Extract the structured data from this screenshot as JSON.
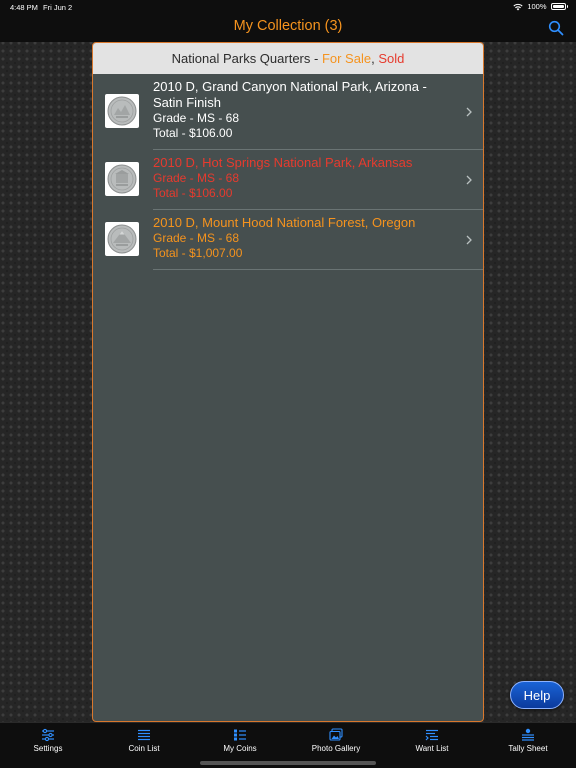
{
  "status_bar": {
    "time": "4:48 PM",
    "date": "Fri Jun 2",
    "battery": "100%"
  },
  "nav": {
    "title": "My Collection (3)"
  },
  "panel": {
    "header_prefix": "National Parks Quarters - ",
    "header_for_sale": "For Sale",
    "header_comma": ", ",
    "header_sold": "Sold"
  },
  "coins": [
    {
      "title": "2010 D, Grand Canyon National Park, Arizona - Satin Finish",
      "grade": "Grade - MS - 68",
      "total": "Total - $106.00",
      "status": "normal"
    },
    {
      "title": "2010 D, Hot Springs National Park, Arkansas",
      "grade": "Grade - MS - 68",
      "total": "Total - $106.00",
      "status": "sold"
    },
    {
      "title": "2010 D, Mount Hood National Forest, Oregon",
      "grade": "Grade - MS - 68",
      "total": "Total - $1,007.00",
      "status": "for-sale"
    }
  ],
  "help_button": "Help",
  "tabs": [
    {
      "label": "Settings",
      "icon": "sliders-icon"
    },
    {
      "label": "Coin List",
      "icon": "list-icon"
    },
    {
      "label": "My Coins",
      "icon": "checklist-icon"
    },
    {
      "label": "Photo Gallery",
      "icon": "photos-icon"
    },
    {
      "label": "Want List",
      "icon": "want-list-icon"
    },
    {
      "label": "Tally Sheet",
      "icon": "tally-icon"
    }
  ],
  "colors": {
    "accent_orange": "#f5931e",
    "sold_red": "#e63b2e",
    "panel_bg": "#464f4f",
    "panel_border": "#d9782d",
    "help_blue": "#1a63d6",
    "tab_icon_blue": "#2f8fff"
  }
}
